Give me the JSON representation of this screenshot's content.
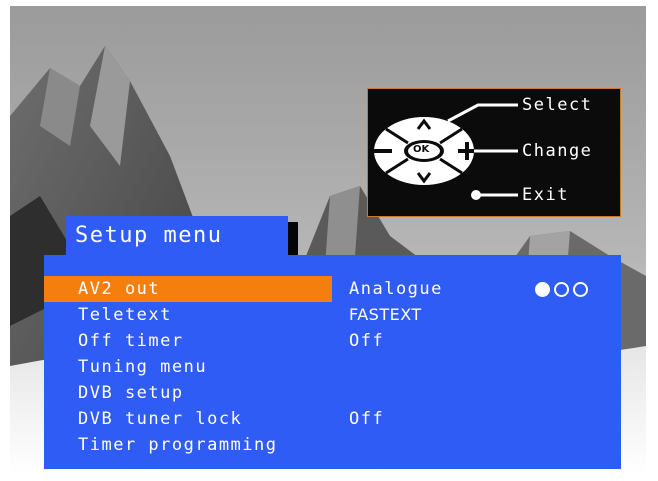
{
  "help": {
    "select_label": "Select",
    "change_label": "Change",
    "exit_label": "Exit",
    "ok_label": "OK"
  },
  "menu": {
    "title": "Setup menu",
    "items": [
      {
        "label": "AV2 out",
        "value": "Analogue",
        "selected": true
      },
      {
        "label": "Teletext",
        "value": "FASTEXT"
      },
      {
        "label": "Off timer",
        "value": "Off"
      },
      {
        "label": "Tuning menu",
        "value": ""
      },
      {
        "label": "DVB setup",
        "value": ""
      },
      {
        "label": "DVB tuner lock",
        "value": "Off"
      },
      {
        "label": "Timer programming",
        "value": ""
      }
    ],
    "option_dots": {
      "count": 3,
      "active_index": 0
    }
  },
  "colors": {
    "menu_blue": "#2f5cf5",
    "highlight_orange": "#f57f0e",
    "panel_border": "#c9792c"
  }
}
